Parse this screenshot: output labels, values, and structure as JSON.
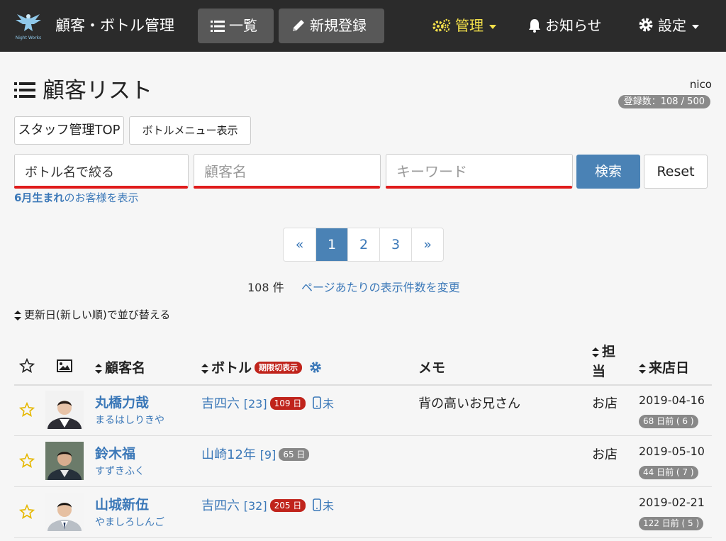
{
  "nav": {
    "brand": "顧客・ボトル管理",
    "logo_text": "Night Works",
    "list_label": "一覧",
    "new_label": "新規登録",
    "admin_label": "管理",
    "notice_label": "お知らせ",
    "settings_label": "設定",
    "admin_color": "#f3e04a"
  },
  "header": {
    "title": "顧客リスト",
    "username": "nico",
    "count_label": "登録数：108 / 500"
  },
  "buttons": {
    "staff_top": "スタッフ管理TOP",
    "bottle_menu": "ボトルメニュー表示"
  },
  "search": {
    "bottle_value": "ボトル名で絞る",
    "name_placeholder": "顧客名",
    "keyword_placeholder": "キーワード",
    "search_label": "検索",
    "reset_label": "Reset",
    "birth_month": "6月生まれ",
    "birth_suffix": "のお客様を表示"
  },
  "pagination": {
    "prev": "«",
    "pages": [
      "1",
      "2",
      "3"
    ],
    "next": "»",
    "active": "1",
    "total": "108 件",
    "per_page_link": "ページあたりの表示件数を変更"
  },
  "sort": {
    "label": "更新日(新しい順)で並び替える"
  },
  "table": {
    "headers": {
      "name": "顧客名",
      "bottle": "ボトル",
      "bottle_badge": "期限切表示",
      "memo": "メモ",
      "staff_1": "担",
      "staff_2": "当",
      "visit": "来店日"
    },
    "rows": [
      {
        "name": "丸橋力哉",
        "kana": "まるはしりきや",
        "bottle": "吉四六",
        "bottle_count": "[23]",
        "days": "109 日",
        "days_color": "red",
        "unread": "未",
        "memo": "背の高いお兄さん",
        "staff": "お店",
        "visit_date": "2019-04-16",
        "visit_ago": "68 日前 ( 6 )"
      },
      {
        "name": "鈴木福",
        "kana": "すずきふく",
        "bottle": "山崎12年",
        "bottle_count": "[9]",
        "days": "65 日",
        "days_color": "gray",
        "unread": "",
        "memo": "",
        "staff": "お店",
        "visit_date": "2019-05-10",
        "visit_ago": "44 日前 ( 7 )"
      },
      {
        "name": "山城新伍",
        "kana": "やましろしんご",
        "bottle": "吉四六",
        "bottle_count": "[32]",
        "days": "205 日",
        "days_color": "red",
        "unread": "未",
        "memo": "",
        "staff": "",
        "visit_date": "2019-02-21",
        "visit_ago": "122 日前 ( 5 )"
      }
    ]
  }
}
